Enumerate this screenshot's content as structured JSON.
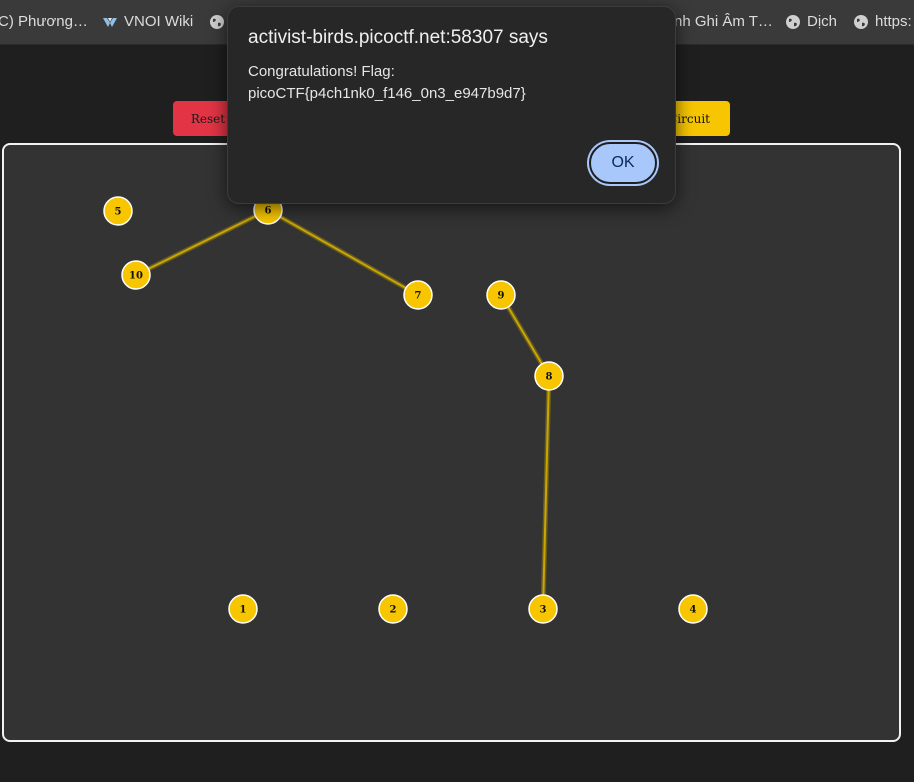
{
  "bookmarks": [
    {
      "label": "C) Phương…",
      "icon": "none"
    },
    {
      "label": "VNOI Wiki",
      "icon": "vnoi-logo-icon"
    },
    {
      "label": "",
      "icon": "globe-icon"
    },
    {
      "label": "nh Ghi Âm T…",
      "icon": "none"
    },
    {
      "label": "Dịch",
      "icon": "globe-icon"
    },
    {
      "label": "https:",
      "icon": "globe-icon"
    }
  ],
  "toolbar": {
    "reset_label": "Reset",
    "circuit_label": "Circuit"
  },
  "nodes": [
    {
      "id": "1",
      "label": "1"
    },
    {
      "id": "2",
      "label": "2"
    },
    {
      "id": "3",
      "label": "3"
    },
    {
      "id": "4",
      "label": "4"
    },
    {
      "id": "5",
      "label": "5"
    },
    {
      "id": "6",
      "label": "6"
    },
    {
      "id": "7",
      "label": "7"
    },
    {
      "id": "8",
      "label": "8"
    },
    {
      "id": "9",
      "label": "9"
    },
    {
      "id": "10",
      "label": "10"
    }
  ],
  "edges": [
    {
      "from": "6",
      "to": "10"
    },
    {
      "from": "6",
      "to": "7"
    },
    {
      "from": "9",
      "to": "8"
    },
    {
      "from": "8",
      "to": "3"
    }
  ],
  "colors": {
    "node_fill": "#f7c600",
    "node_stroke": "#ffffff",
    "edge": "#c9a600",
    "reset": "#e23444",
    "circuit": "#f7c600",
    "ok_button": "#a8c7fa"
  },
  "dialog": {
    "title": "activist-birds.picoctf.net:58307 says",
    "message_line1": "Congratulations! Flag:",
    "message_line2": "picoCTF{p4ch1nk0_f146_0n3_e947b9d7}",
    "ok_label": "OK"
  }
}
